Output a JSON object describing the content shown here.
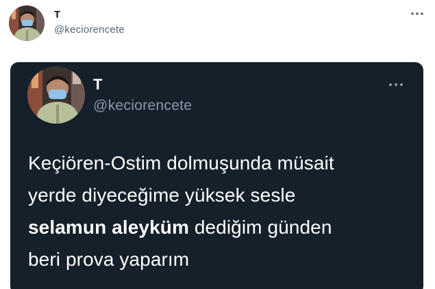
{
  "outer_tweet": {
    "name": "T",
    "handle": "@keciorencete",
    "more_icon": "more-icon"
  },
  "quoted_tweet": {
    "name": "T",
    "handle": "@keciorencete",
    "more_icon": "more-icon",
    "text_line_1": "Keçiören-Ostim dolmuşunda müsait",
    "text_line_2": "yerde diyeceğime yüksek sesle",
    "text_line_3_bold": "selamun aleyküm",
    "text_line_3_rest": " dediğim günden",
    "text_line_4": "beri prova yaparım"
  },
  "colors": {
    "card_background": "#15202b",
    "handle_light": "#536471",
    "handle_dark": "#8b98a5",
    "avatar_mask": "#8fc3e8",
    "avatar_jacket": "#b7c09a"
  }
}
